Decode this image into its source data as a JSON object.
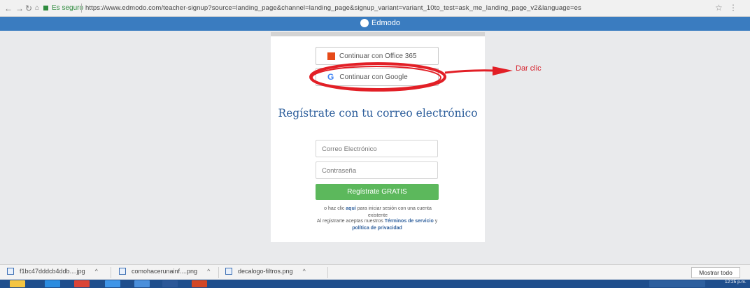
{
  "browser": {
    "secure_label": "Es seguro",
    "url": "https://www.edmodo.com/teacher-signup?source=landing_page&channel=landing_page&signup_variant=variant_10to_test=ask_me_landing_page_v2&language=es",
    "star_icon": "star-icon",
    "menu_icon": "menu-icon"
  },
  "header": {
    "brand": "Edmodo"
  },
  "card": {
    "office_label": "Continuar con Office 365",
    "google_label": "Continuar con Google",
    "title": "Regístrate con tu correo electrónico",
    "email_placeholder": "Correo Electrónico",
    "password_placeholder": "Contraseña",
    "signup_label": "Regístrate GRATIS",
    "login_text_a": "o haz clic",
    "login_link": "aquí",
    "login_text_b": "para iniciar sesión con una cuenta existente",
    "terms_text_a": "Al registrarte aceptas nuestros",
    "terms_link": "Términos de servicio",
    "terms_text_b": "y",
    "privacy_link": "política de privacidad"
  },
  "annotation": {
    "label": "Dar clic",
    "color": "#d6202b"
  },
  "downloads": {
    "items": [
      {
        "name": "f1bc47dddcb4ddb....jpg"
      },
      {
        "name": "comohacerunainf....png"
      },
      {
        "name": "decalogo-filtros.png"
      }
    ],
    "show_all": "Mostrar todo"
  },
  "taskbar": {
    "apps": [
      "start-icon",
      "file-explorer-icon",
      "chrome-icon",
      "ie-icon",
      "chrome-window-icon",
      "word-icon",
      "powerpoint-icon"
    ],
    "clock": "12:25 p.m."
  },
  "colors": {
    "header": "#3a7cc0",
    "signup": "#5cb85c",
    "title": "#2e5f9c",
    "taskbar": "#1f4e8c"
  }
}
